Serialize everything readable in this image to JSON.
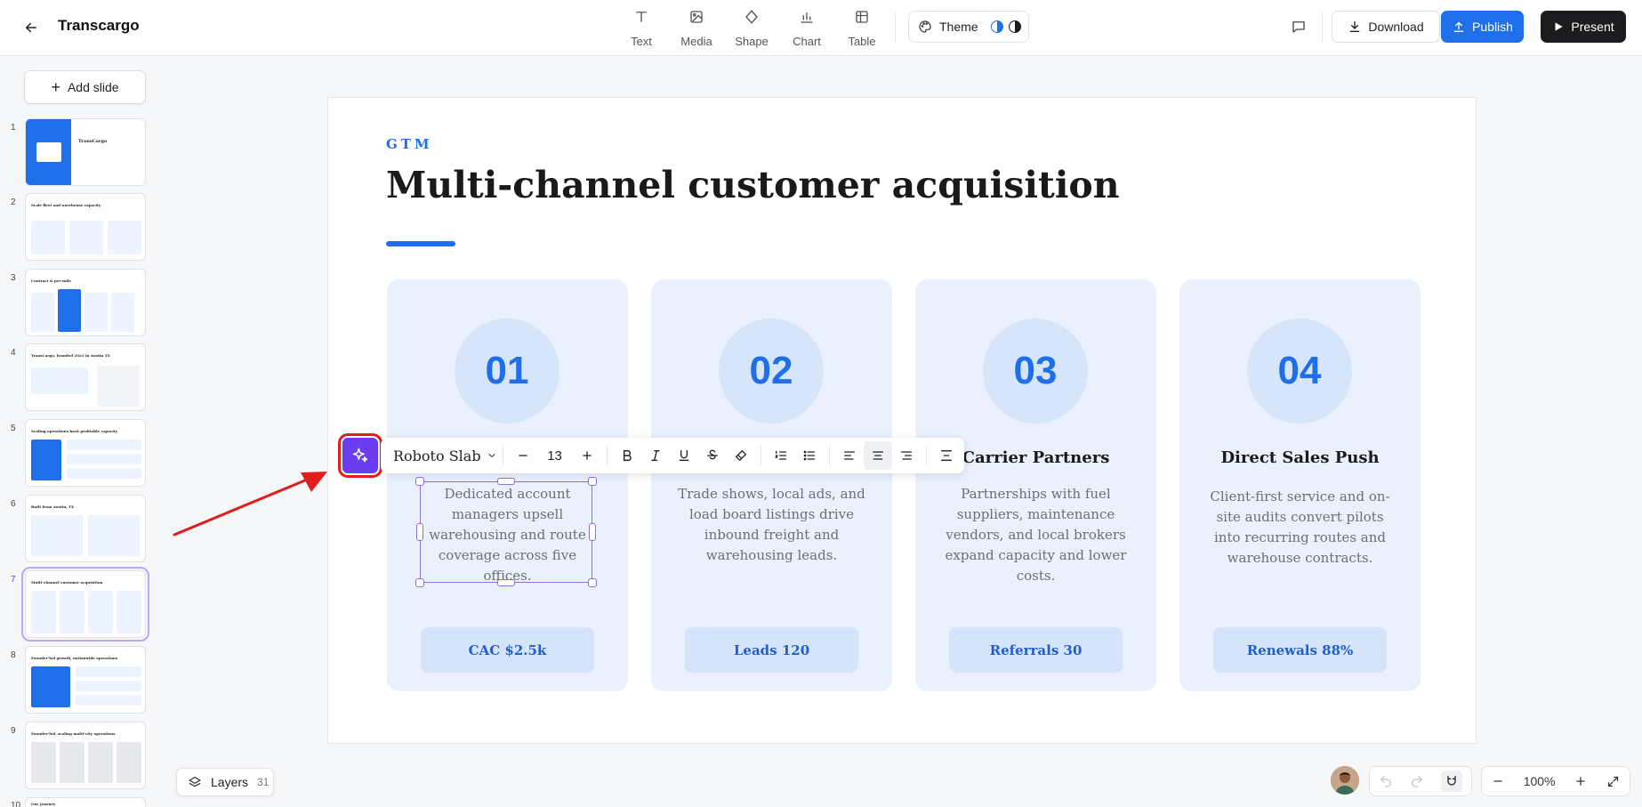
{
  "header": {
    "title": "Transcargo",
    "tools": [
      {
        "label": "Text",
        "icon": "text-icon"
      },
      {
        "label": "Media",
        "icon": "image-icon"
      },
      {
        "label": "Shape",
        "icon": "shape-icon"
      },
      {
        "label": "Chart",
        "icon": "chart-icon"
      },
      {
        "label": "Table",
        "icon": "table-icon"
      }
    ],
    "theme_label": "Theme",
    "download_label": "Download",
    "publish_label": "Publish",
    "present_label": "Present"
  },
  "sidebar": {
    "add_slide_label": "Add slide",
    "active_index": 7,
    "thumbnails": [
      {
        "num": "1",
        "title": "TransCargo"
      },
      {
        "num": "2",
        "title": "Scale fleet and warehouse capacity"
      },
      {
        "num": "3",
        "title": "Contract & per-mile"
      },
      {
        "num": "4",
        "title": "TransCargo, founded 2023 in Austin TX"
      },
      {
        "num": "5",
        "title": "Scaling operations back profitable capacity"
      },
      {
        "num": "6",
        "title": "Built from Austin, TX"
      },
      {
        "num": "7",
        "title": "Multi-channel customer acquisition"
      },
      {
        "num": "8",
        "title": "Founder-led growth, nationwide operations"
      },
      {
        "num": "9",
        "title": "Founder-led, scaling multi-city operations"
      },
      {
        "num": "10",
        "title": "Our Journey"
      }
    ]
  },
  "slide": {
    "eyebrow": "GTM",
    "title": "Multi-channel customer acquisition",
    "cards": [
      {
        "number": "01",
        "heading": "",
        "body": "Dedicated account managers upsell warehousing and route coverage across five offices.",
        "metric": "CAC $2.5k"
      },
      {
        "number": "02",
        "heading": "",
        "body": "Trade shows, local ads, and load board listings drive inbound freight and warehousing leads.",
        "metric": "Leads 120"
      },
      {
        "number": "03",
        "heading": "Carrier Partners",
        "body": "Partnerships with fuel suppliers, maintenance vendors, and local brokers expand capacity and lower costs.",
        "metric": "Referrals 30"
      },
      {
        "number": "04",
        "heading": "Direct Sales Push",
        "body": "Client-first service and on-site audits convert pilots into recurring routes and warehouse contracts.",
        "metric": "Renewals 88%"
      }
    ]
  },
  "format_toolbar": {
    "font_family": "Roboto Slab",
    "font_size": "13"
  },
  "footer": {
    "layers_label": "Layers",
    "layers_count": "31",
    "zoom_level": "100%"
  },
  "colors": {
    "accent": "#1f6feb",
    "ai_button": "#6b3df0",
    "highlight": "#e11d1d"
  }
}
